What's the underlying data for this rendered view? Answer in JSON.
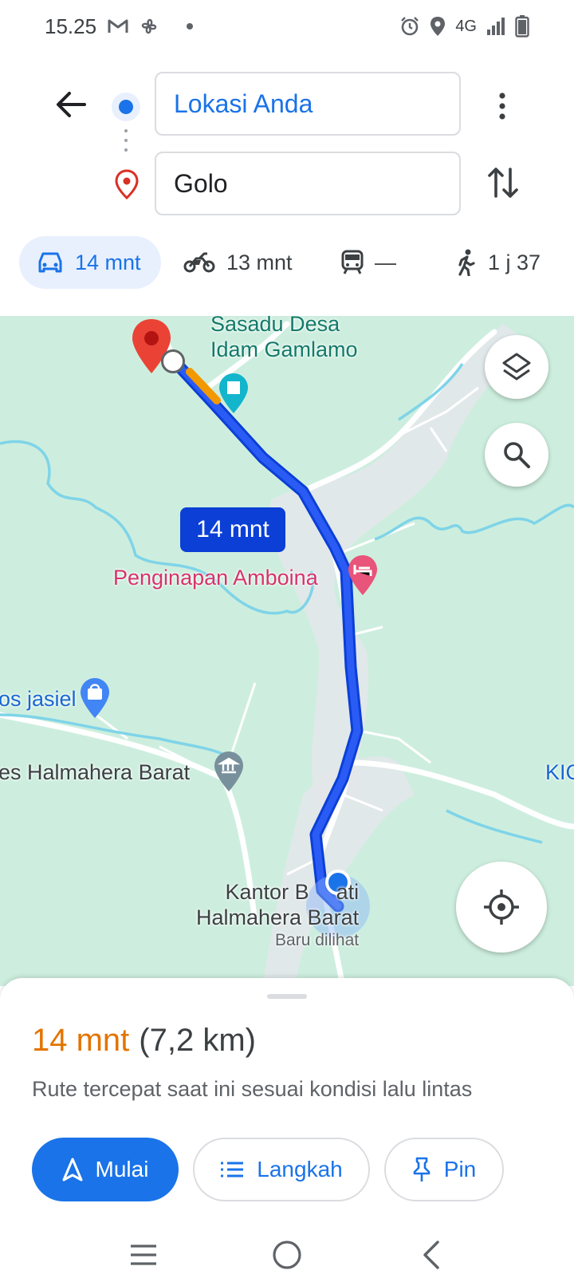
{
  "status_bar": {
    "time": "15.25",
    "network": "4G",
    "icons_left": [
      "gmail-icon",
      "fan-icon",
      "dot-icon"
    ],
    "icons_right": [
      "alarm-icon",
      "location-icon",
      "signal-icon",
      "battery-icon"
    ]
  },
  "directions": {
    "origin": "Lokasi Anda",
    "destination": "Golo",
    "modes": [
      {
        "name": "car",
        "label": "14 mnt",
        "active": true
      },
      {
        "name": "motorcycle",
        "label": "13 mnt"
      },
      {
        "name": "transit",
        "label": "—"
      },
      {
        "name": "walk",
        "label": "1 j 37"
      }
    ]
  },
  "map": {
    "labels": {
      "sasadu_line1": "Sasadu Desa",
      "sasadu_line2": "Idam Gamlamo",
      "penginapan": "Penginapan Amboina",
      "jasiel": "os jasiel",
      "halmahera": "es Halmahera Barat",
      "kic": "KIC",
      "kantor_line1": "Kantor B",
      "kantor_line1_end": "ati",
      "kantor_line2": "Halmahera Barat",
      "recent": "Baru dilihat"
    },
    "eta_bubble": "14 mnt",
    "route_color": "#0b3fd6",
    "traffic_color": "#f29900"
  },
  "sheet": {
    "time": "14 mnt",
    "distance": "(7,2 km)",
    "subtitle": "Rute tercepat saat ini sesuai kondisi lalu lintas",
    "start_label": "Mulai",
    "steps_label": "Langkah",
    "pin_label": "Pin"
  },
  "colors": {
    "accent": "#1a73e8",
    "eta_orange": "#e37400",
    "map_bg": "#cdeede"
  }
}
